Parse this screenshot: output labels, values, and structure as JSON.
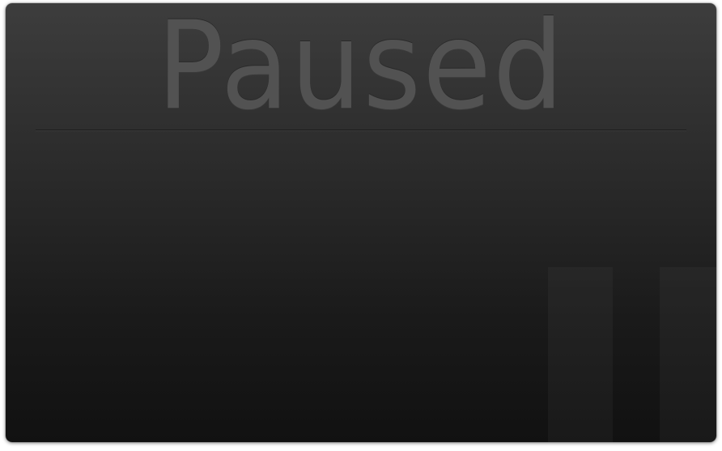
{
  "screen": {
    "title": "Paused"
  },
  "colors": {
    "background_top": "#3d3d3d",
    "background_bottom": "#111111",
    "title_text": "#525252",
    "divider": "#1c1c1c"
  },
  "icons": {
    "pause": "pause-icon"
  }
}
